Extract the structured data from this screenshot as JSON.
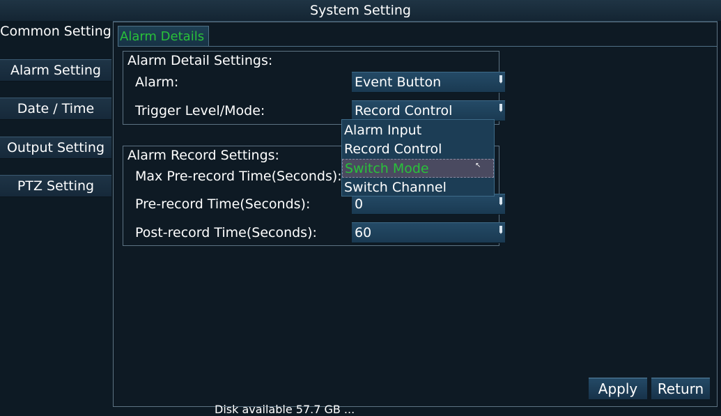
{
  "window": {
    "title": "System Setting"
  },
  "sidebar": {
    "items": [
      {
        "label": "Common Setting"
      },
      {
        "label": "Alarm Setting"
      },
      {
        "label": "Date / Time"
      },
      {
        "label": "Output Setting"
      },
      {
        "label": "PTZ Setting"
      }
    ]
  },
  "tabs": [
    {
      "label": "Alarm Details"
    }
  ],
  "alarm_detail": {
    "title": "Alarm Detail Settings:",
    "alarm_label": "Alarm:",
    "alarm_value": "Event Button",
    "trigger_label": "Trigger Level/Mode:",
    "trigger_value": "Record Control"
  },
  "dropdown": {
    "options": [
      {
        "label": "Alarm Input"
      },
      {
        "label": "Record Control"
      },
      {
        "label": "Switch Mode"
      },
      {
        "label": "Switch Channel"
      }
    ],
    "highlighted": "Switch Mode"
  },
  "record": {
    "title": "Alarm Record Settings:",
    "max_pre_label": "Max Pre-record Time(Seconds):",
    "pre_label": "Pre-record Time(Seconds):",
    "pre_value": "0",
    "post_label": "Post-record Time(Seconds):",
    "post_value": "60"
  },
  "buttons": {
    "apply": "Apply",
    "return": "Return"
  },
  "footer": {
    "text": "Disk available 57.7 GB ... "
  },
  "colors": {
    "accent_green": "#29c13a",
    "highlight": "#4a4a60",
    "panel": "#1c3d55"
  }
}
